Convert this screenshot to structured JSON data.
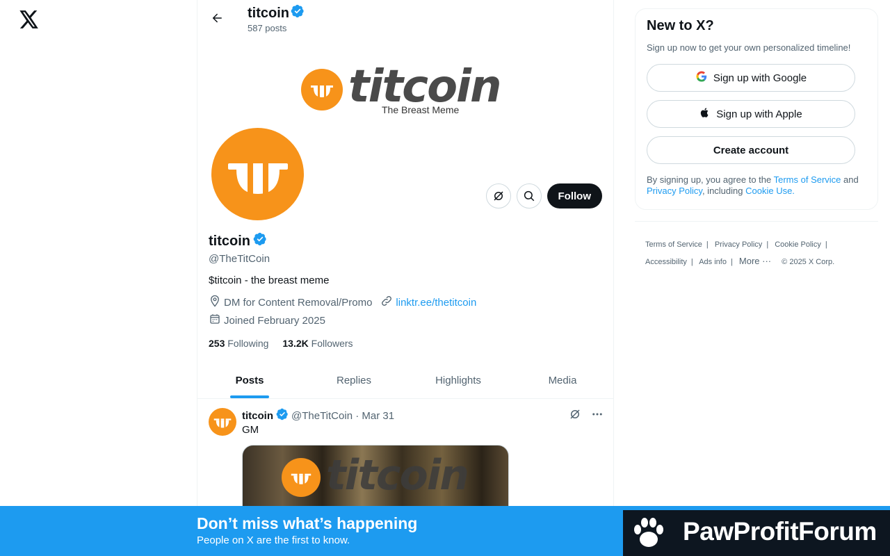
{
  "nav": {
    "logo_icon": "x-logo-icon"
  },
  "header": {
    "title": "titcoin",
    "post_count": "587 posts"
  },
  "banner": {
    "word": "titcoin",
    "tagline": "The Breast Meme"
  },
  "profile": {
    "name": "titcoin",
    "handle": "@TheTitCoin",
    "bio": "$titcoin - the breast meme",
    "location": "DM for Content Removal/Promo",
    "link": "linktr.ee/thetitcoin",
    "joined": "Joined February 2025",
    "following_count": "253",
    "following_label": "Following",
    "followers_count": "13.2K",
    "followers_label": "Followers",
    "follow_label": "Follow"
  },
  "tabs": [
    {
      "label": "Posts"
    },
    {
      "label": "Replies"
    },
    {
      "label": "Highlights"
    },
    {
      "label": "Media"
    }
  ],
  "post": {
    "name": "titcoin",
    "handle_date": "@TheTitCoin · Mar 31",
    "text": "GM",
    "media_word": "titcoin"
  },
  "signup": {
    "title": "New to X?",
    "subtitle": "Sign up now to get your own personalized timeline!",
    "google": "Sign up with Google",
    "apple": "Sign up with Apple",
    "create": "Create account",
    "terms_pre": "By signing up, you agree to the ",
    "terms_link": "Terms of Service",
    "terms_and": " and ",
    "privacy_link": "Privacy Policy",
    "terms_mid": ", including ",
    "cookie_link": "Cookie Use."
  },
  "footer": {
    "items": [
      "Terms of Service",
      "Privacy Policy",
      "Cookie Policy",
      "Accessibility",
      "Ads info",
      "More ···",
      "© 2025 X Corp."
    ]
  },
  "bottom_bar": {
    "title": "Don’t miss what’s happening",
    "subtitle": "People on X are the first to know."
  },
  "watermark": {
    "text": "PawProfitForum"
  },
  "colors": {
    "accent": "#1d9bf0",
    "coin": "#f7931a",
    "text": "#0f1419",
    "muted": "#536471"
  }
}
